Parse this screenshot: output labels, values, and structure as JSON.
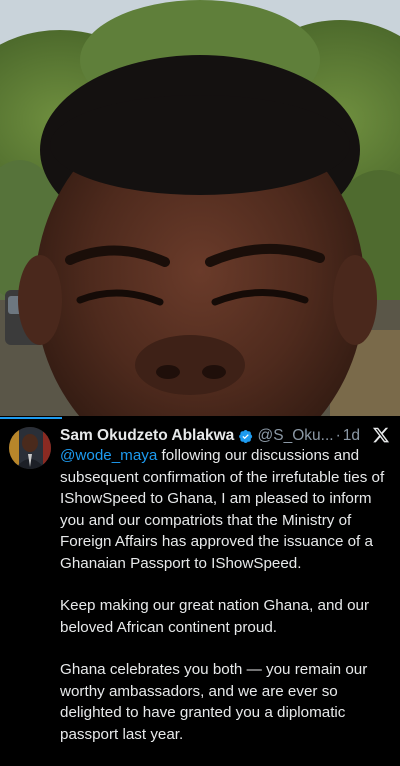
{
  "tweet": {
    "author_name": "Sam Okudzeto Ablakwa",
    "author_handle": "@S_Oku...",
    "separator": "·",
    "time": "1d",
    "mention": "@wode_maya",
    "paragraph1_rest": " following our discussions and subsequent confirmation of the irrefutable ties of IShowSpeed to Ghana, I am pleased to inform you and our compatriots that the Ministry of Foreign Affairs has approved the issuance of a Ghanaian Passport to IShowSpeed.",
    "paragraph2": "Keep making our great nation Ghana, and our beloved African continent proud.",
    "paragraph3": "Ghana celebrates you both — you remain our worthy ambassadors, and we are ever so delighted to have granted you a diplomatic passport last year."
  },
  "colors": {
    "background": "#000000",
    "text": "#e7e9ea",
    "secondary_text": "#8b98a5",
    "link": "#1d9bf0",
    "verified_badge": "#1d9bf0"
  },
  "icons": {
    "verified": "verified-badge-icon",
    "platform": "x-logo-icon"
  }
}
